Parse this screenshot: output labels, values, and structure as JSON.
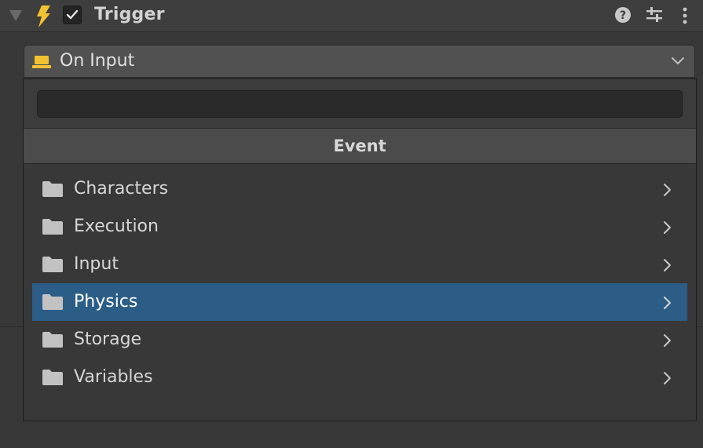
{
  "component": {
    "title": "Trigger",
    "enabled": true,
    "icons": [
      "foldout-arrow-icon",
      "lightning-bolt-icon",
      "help-icon",
      "settings-sliders-icon",
      "more-options-icon"
    ]
  },
  "field": {
    "selected_label": "On Input",
    "icon": "input-device-icon"
  },
  "dropdown": {
    "search_value": "",
    "section_title": "Event",
    "items": [
      {
        "label": "Characters",
        "selected": false
      },
      {
        "label": "Execution",
        "selected": false
      },
      {
        "label": "Input",
        "selected": false
      },
      {
        "label": "Physics",
        "selected": true
      },
      {
        "label": "Storage",
        "selected": false
      },
      {
        "label": "Variables",
        "selected": false
      }
    ]
  },
  "colors": {
    "background": "#383838",
    "header": "#3e3e3e",
    "selection": "#2c5d87",
    "accent_yellow": "#f1c232"
  }
}
